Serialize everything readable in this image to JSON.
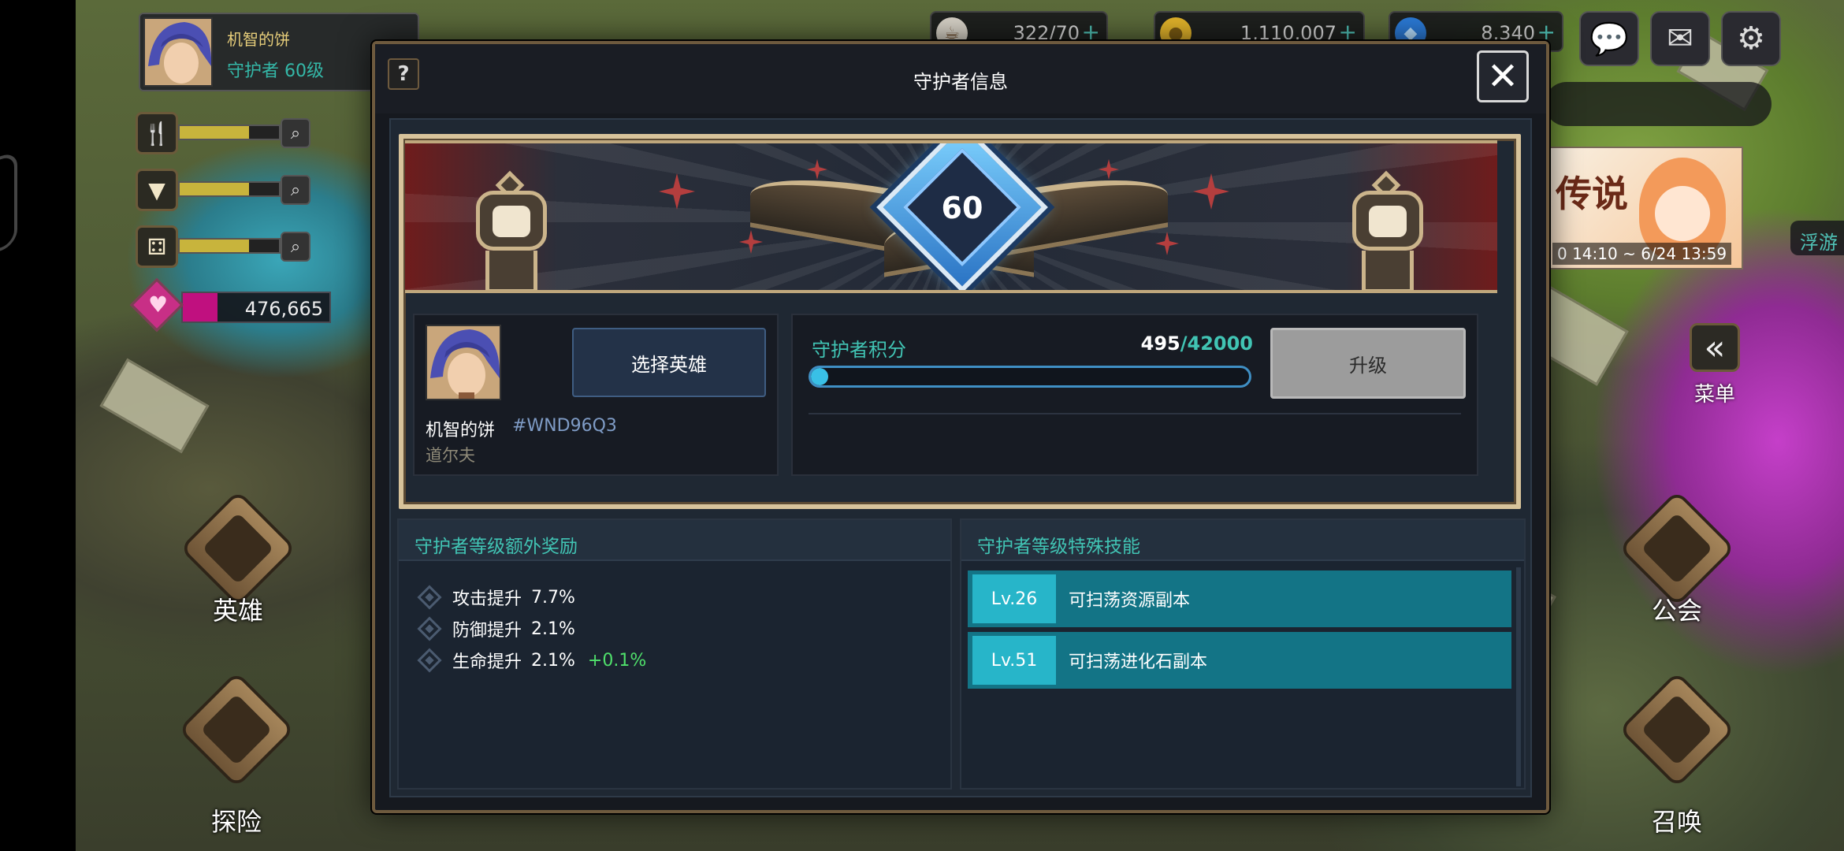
{
  "hud": {
    "player_name": "机智的饼",
    "player_level": "守护者 60级",
    "resources": [
      {
        "icon": "food-icon",
        "fill": 0.7
      },
      {
        "icon": "drink-icon",
        "fill": 0.7
      },
      {
        "icon": "dice-icon",
        "fill": 0.7
      }
    ],
    "gem_value": "476,665",
    "currencies": [
      {
        "icon": "coffee-icon",
        "value": "322/70"
      },
      {
        "icon": "gold-coin-icon",
        "value": "1,110,007"
      },
      {
        "icon": "blue-crystal-icon",
        "value": "8,340"
      }
    ],
    "banner_title": "传说",
    "banner_date": "0 14:10 ~ 6/24 13:59",
    "float_tag": "浮游",
    "menu_label": "菜单",
    "nav": {
      "hero": "英雄",
      "explore": "探险",
      "guild": "公会",
      "summon": "召唤"
    }
  },
  "dialog": {
    "title": "守护者信息",
    "help": "?",
    "close": "✕",
    "level": "60",
    "player": {
      "name": "机智的饼",
      "id": "#WND96Q3",
      "class": "道尔夫",
      "select_hero": "选择英雄"
    },
    "points": {
      "label": "守护者积分",
      "current": "495",
      "max": "/42000",
      "fraction": 0.012,
      "upgrade": "升级"
    },
    "bonus": {
      "title": "守护者等级额外奖励",
      "items": [
        {
          "label": "攻击提升",
          "value": "7.7%",
          "extra": ""
        },
        {
          "label": "防御提升",
          "value": "2.1%",
          "extra": ""
        },
        {
          "label": "生命提升",
          "value": "2.1%",
          "extra": "+0.1%"
        }
      ]
    },
    "skills": {
      "title": "守护者等级特殊技能",
      "items": [
        {
          "level": "Lv.26",
          "text": "可扫荡资源副本"
        },
        {
          "level": "Lv.51",
          "text": "可扫荡进化石副本"
        }
      ]
    }
  }
}
